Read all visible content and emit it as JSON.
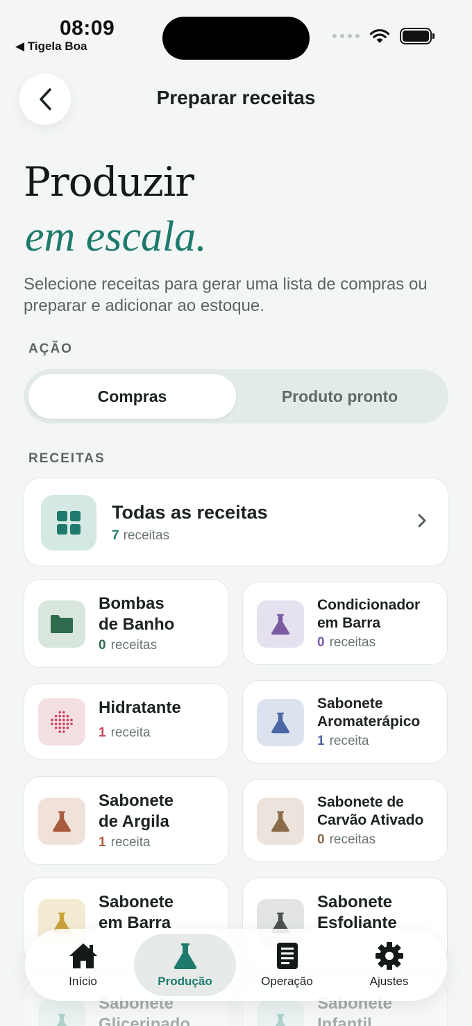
{
  "status": {
    "time": "08:09",
    "back_app": "◀ Tigela Boa"
  },
  "nav": {
    "title": "Preparar receitas"
  },
  "hero": {
    "title": "Produzir",
    "title_accent": "em escala.",
    "subtitle": "Selecione receitas para gerar uma lista de compras ou preparar e adicionar ao estoque."
  },
  "action": {
    "label": "AÇÃO",
    "options": [
      "Compras",
      "Produto pronto"
    ],
    "selected": "Compras"
  },
  "recipes": {
    "label": "RECEITAS",
    "all": {
      "title": "Todas as receitas",
      "count": "7",
      "unit": "receitas"
    },
    "categories": [
      {
        "title": "Bombas\nde Banho",
        "count": "0",
        "unit": "receitas",
        "icon": "folder-icon",
        "color": "#2f6b4c",
        "bg": "#d9e6de"
      },
      {
        "title": "Condicionador\nem Barra",
        "count": "0",
        "unit": "receitas",
        "icon": "flask-icon",
        "color": "#7a5aa3",
        "bg": "#e6e1ee"
      },
      {
        "title": "Hidratante",
        "count": "1",
        "unit": "receita",
        "icon": "dots-icon",
        "color": "#c9435a",
        "bg": "#f4dfe2"
      },
      {
        "title": "Sabonete\nAromaterápico",
        "count": "1",
        "unit": "receita",
        "icon": "flask-icon",
        "color": "#4d66a6",
        "bg": "#dde3ee"
      },
      {
        "title": "Sabonete\nde Argila",
        "count": "1",
        "unit": "receita",
        "icon": "flask-icon",
        "color": "#a85a3e",
        "bg": "#f0e1da"
      },
      {
        "title": "Sabonete de\nCarvão Ativado",
        "count": "0",
        "unit": "receitas",
        "icon": "flask-icon",
        "color": "#8b6a4a",
        "bg": "#ece4dc"
      },
      {
        "title": "Sabonete\nem Barra",
        "count": "",
        "unit": "",
        "icon": "flask-icon",
        "color": "#c9a23a",
        "bg": "#f3ebd2"
      },
      {
        "title": "Sabonete\nEsfoliante",
        "count": "",
        "unit": "",
        "icon": "flask-icon",
        "color": "#4a5250",
        "bg": "#e2e5e4"
      },
      {
        "title": "Sabonete\nGlicerinado",
        "count": "",
        "unit": "",
        "icon": "flask-icon",
        "color": "#2f8f7e",
        "bg": "#dcefeb"
      },
      {
        "title": "Sabonete\nInfantil",
        "count": "",
        "unit": "",
        "icon": "flask-icon",
        "color": "#2f8f7e",
        "bg": "#dcefeb"
      }
    ]
  },
  "tabs": [
    {
      "label": "Início",
      "icon": "home-icon"
    },
    {
      "label": "Produção",
      "icon": "flask-icon"
    },
    {
      "label": "Operação",
      "icon": "document-icon"
    },
    {
      "label": "Ajustes",
      "icon": "gear-icon"
    }
  ],
  "active_tab": "Produção",
  "colors": {
    "accent": "#1d7a6c",
    "background": "#f3f6f5"
  }
}
